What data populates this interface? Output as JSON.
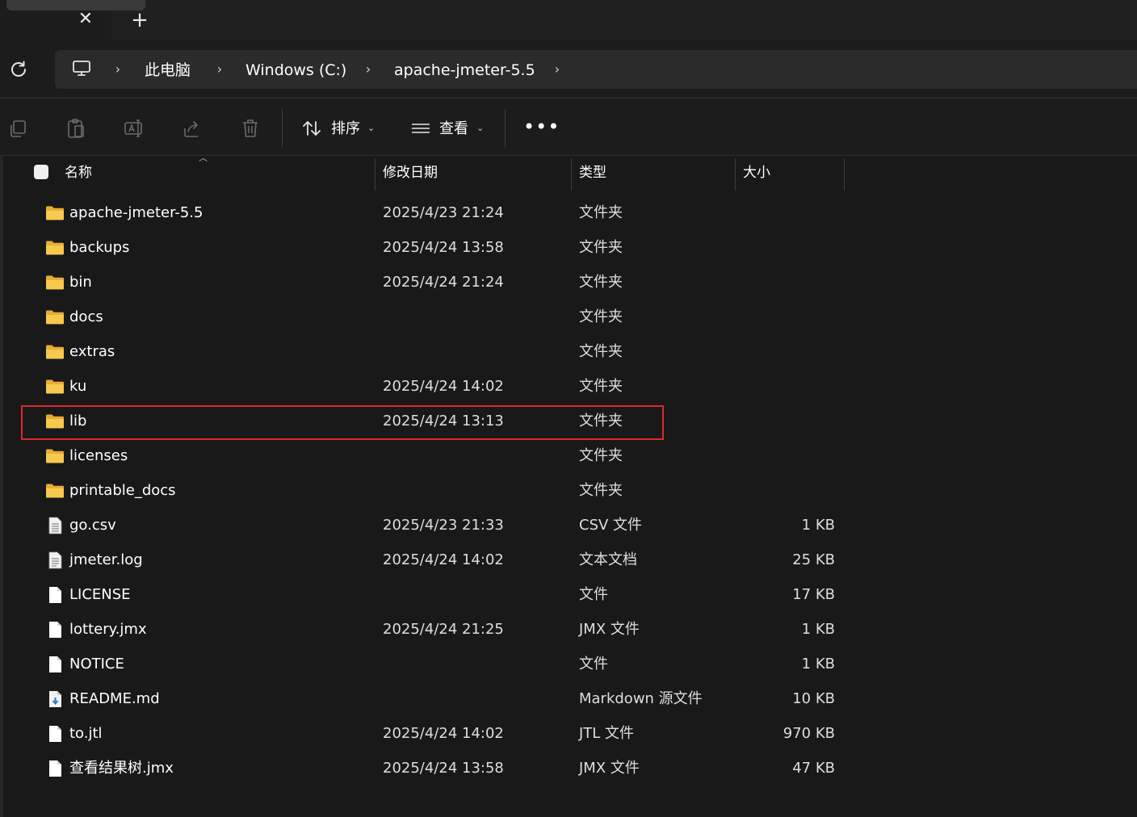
{
  "tabbar": {
    "close_glyph": "✕",
    "new_tab_glyph": "+"
  },
  "address": {
    "segments": [
      "此电脑",
      "Windows (C:)",
      "apache-jmeter-5.5"
    ],
    "separator": "›",
    "icons": [
      "refresh-icon",
      "computer-icon"
    ]
  },
  "toolbar": {
    "icons": [
      "copy-icon",
      "paste-icon",
      "rename-icon",
      "share-icon",
      "delete-icon"
    ],
    "sort_label": "排序",
    "view_label": "查看",
    "more_label": "•••"
  },
  "columns": {
    "name": "名称",
    "modified": "修改日期",
    "type": "类型",
    "size": "大小"
  },
  "files": [
    {
      "name": "apache-jmeter-5.5",
      "modified": "2025/4/23 21:24",
      "type": "文件夹",
      "size": "",
      "icon": "folder-icon"
    },
    {
      "name": "backups",
      "modified": "2025/4/24 13:58",
      "type": "文件夹",
      "size": "",
      "icon": "folder-icon"
    },
    {
      "name": "bin",
      "modified": "2025/4/24 21:24",
      "type": "文件夹",
      "size": "",
      "icon": "folder-icon"
    },
    {
      "name": "docs",
      "modified": "",
      "type": "文件夹",
      "size": "",
      "icon": "folder-icon"
    },
    {
      "name": "extras",
      "modified": "",
      "type": "文件夹",
      "size": "",
      "icon": "folder-icon"
    },
    {
      "name": "ku",
      "modified": "2025/4/24 14:02",
      "type": "文件夹",
      "size": "",
      "icon": "folder-icon"
    },
    {
      "name": "lib",
      "modified": "2025/4/24 13:13",
      "type": "文件夹",
      "size": "",
      "icon": "folder-icon",
      "highlighted": true
    },
    {
      "name": "licenses",
      "modified": "",
      "type": "文件夹",
      "size": "",
      "icon": "folder-icon"
    },
    {
      "name": "printable_docs",
      "modified": "",
      "type": "文件夹",
      "size": "",
      "icon": "folder-icon"
    },
    {
      "name": "go.csv",
      "modified": "2025/4/23 21:33",
      "type": "CSV 文件",
      "size": "1 KB",
      "icon": "csv-file-icon"
    },
    {
      "name": "jmeter.log",
      "modified": "2025/4/24 14:02",
      "type": "文本文档",
      "size": "25 KB",
      "icon": "text-file-icon"
    },
    {
      "name": "LICENSE",
      "modified": "",
      "type": "文件",
      "size": "17 KB",
      "icon": "file-icon"
    },
    {
      "name": "lottery.jmx",
      "modified": "2025/4/24 21:25",
      "type": "JMX 文件",
      "size": "1 KB",
      "icon": "file-icon"
    },
    {
      "name": "NOTICE",
      "modified": "",
      "type": "文件",
      "size": "1 KB",
      "icon": "file-icon"
    },
    {
      "name": "README.md",
      "modified": "",
      "type": "Markdown 源文件",
      "size": "10 KB",
      "icon": "markdown-file-icon"
    },
    {
      "name": "to.jtl",
      "modified": "2025/4/24 14:02",
      "type": "JTL 文件",
      "size": "970 KB",
      "icon": "file-icon"
    },
    {
      "name": "查看结果树.jmx",
      "modified": "2025/4/24 13:58",
      "type": "JMX 文件",
      "size": "47 KB",
      "icon": "file-icon"
    }
  ],
  "colors": {
    "background": "#191919",
    "folder": "#f4c34a",
    "highlight_border": "#e0272a"
  }
}
